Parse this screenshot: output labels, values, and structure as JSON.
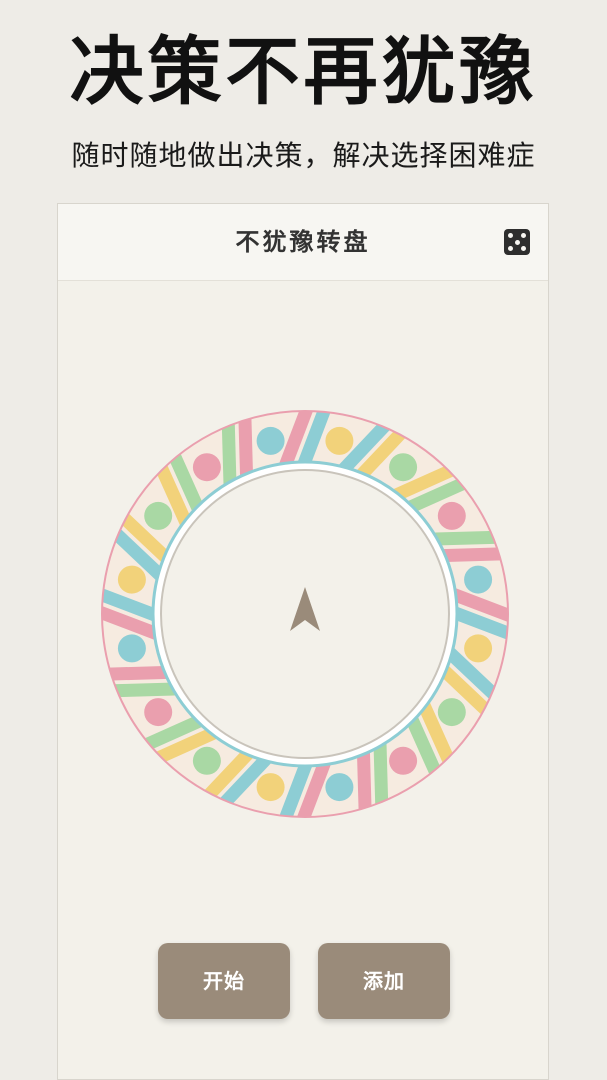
{
  "promo": {
    "title": "决策不再犹豫",
    "subtitle": "随时随地做出决策，解决选择困难症"
  },
  "app": {
    "title": "不犹豫转盘",
    "dice_icon": "dice-icon"
  },
  "wheel": {
    "colors": {
      "pink": "#ea9fae",
      "blue": "#8dcdd4",
      "yellow": "#f2d27a",
      "green": "#a9d8a4",
      "base": "#f6ebe0",
      "inner": "#f3f1ea",
      "pointer": "#9a8b7a"
    }
  },
  "buttons": {
    "start_label": "开始",
    "add_label": "添加"
  }
}
